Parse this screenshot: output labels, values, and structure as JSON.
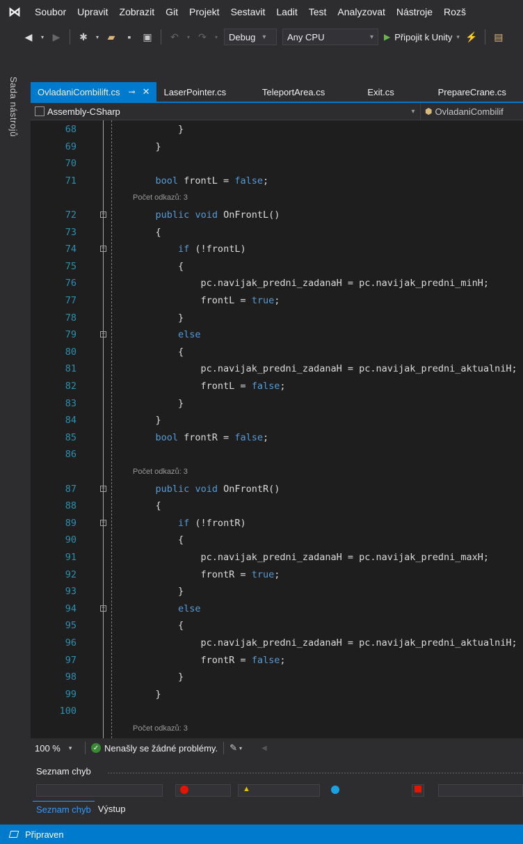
{
  "menu": {
    "logo_icon": "visual-studio-logo",
    "items": [
      "Soubor",
      "Upravit",
      "Zobrazit",
      "Git",
      "Projekt",
      "Sestavit",
      "Ladit",
      "Test",
      "Analyzovat",
      "Nástroje",
      "Rozš"
    ]
  },
  "toolbar": {
    "configuration": "Debug",
    "platform": "Any CPU",
    "run_label": "Připojit k Unity"
  },
  "side_panel": {
    "label": "Sada nástrojů"
  },
  "tabs": [
    {
      "label": "OvladaniCombilift.cs",
      "active": true
    },
    {
      "label": "LaserPointer.cs"
    },
    {
      "label": "TeleportArea.cs"
    },
    {
      "label": "Exit.cs"
    },
    {
      "label": "PrepareCrane.cs"
    }
  ],
  "nav": {
    "project": "Assembly-CSharp",
    "member": "OvladaniCombilif"
  },
  "code_lines": [
    {
      "n": "68",
      "t": "        }"
    },
    {
      "n": "69",
      "t": "    }"
    },
    {
      "n": "70",
      "t": ""
    },
    {
      "n": "71",
      "t": "    bool frontL = false;"
    },
    {
      "lens": "Počet odkazů: 3"
    },
    {
      "n": "72",
      "t": "    public void OnFrontL()"
    },
    {
      "n": "73",
      "t": "    {"
    },
    {
      "n": "74",
      "t": "        if (!frontL)"
    },
    {
      "n": "75",
      "t": "        {"
    },
    {
      "n": "76",
      "t": "            pc.navijak_predni_zadanaH = pc.navijak_predni_minH;"
    },
    {
      "n": "77",
      "t": "            frontL = true;"
    },
    {
      "n": "78",
      "t": "        }"
    },
    {
      "n": "79",
      "t": "        else"
    },
    {
      "n": "80",
      "t": "        {"
    },
    {
      "n": "81",
      "t": "            pc.navijak_predni_zadanaH = pc.navijak_predni_aktualniH;"
    },
    {
      "n": "82",
      "t": "            frontL = false;"
    },
    {
      "n": "83",
      "t": "        }"
    },
    {
      "n": "84",
      "t": "    }"
    },
    {
      "n": "85",
      "t": "    bool frontR = false;"
    },
    {
      "n": "86",
      "t": ""
    },
    {
      "lens": "Počet odkazů: 3"
    },
    {
      "n": "87",
      "t": "    public void OnFrontR()"
    },
    {
      "n": "88",
      "t": "    {"
    },
    {
      "n": "89",
      "t": "        if (!frontR)"
    },
    {
      "n": "90",
      "t": "        {"
    },
    {
      "n": "91",
      "t": "            pc.navijak_predni_zadanaH = pc.navijak_predni_maxH;"
    },
    {
      "n": "92",
      "t": "            frontR = true;"
    },
    {
      "n": "93",
      "t": "        }"
    },
    {
      "n": "94",
      "t": "        else"
    },
    {
      "n": "95",
      "t": "        {"
    },
    {
      "n": "96",
      "t": "            pc.navijak_predni_zadanaH = pc.navijak_predni_aktualniH;"
    },
    {
      "n": "97",
      "t": "            frontR = false;"
    },
    {
      "n": "98",
      "t": "        }"
    },
    {
      "n": "99",
      "t": "    }"
    },
    {
      "n": "100",
      "t": ""
    },
    {
      "lens": "Počet odkazů: 3"
    }
  ],
  "status_strip": {
    "zoom": "100 %",
    "issues": "Nenašly se žádné problémy."
  },
  "error_panel": {
    "title": "Seznam chyb",
    "tabs": [
      "Seznam chyb",
      "Výstup"
    ]
  },
  "statusbar": {
    "text": "Připraven"
  },
  "colors": {
    "accent": "#007acc",
    "keyword": "#569cd6",
    "line_number": "#2b91af",
    "editor_bg": "#1e1e1e",
    "chrome_bg": "#2d2d30"
  }
}
